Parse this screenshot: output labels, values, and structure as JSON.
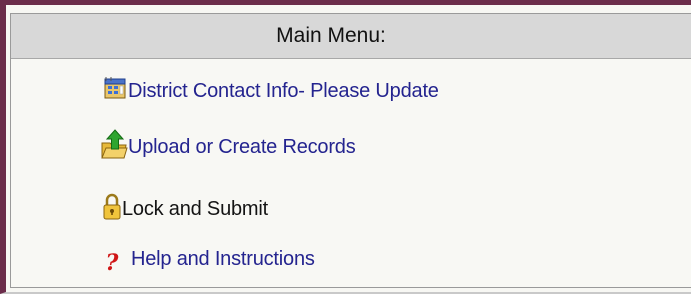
{
  "menu": {
    "title": "Main Menu:",
    "items": [
      {
        "label": "District Contact Info- Please Update",
        "icon": "address-book-icon"
      },
      {
        "label": "Upload or Create Records",
        "icon": "folder-upload-icon"
      },
      {
        "label": "Lock and Submit",
        "icon": "padlock-icon"
      },
      {
        "label": "Help and Instructions",
        "icon": "question-mark-icon"
      }
    ]
  },
  "colors": {
    "frame_border": "#6b2c4a",
    "header_bg": "#d8d8d8",
    "link_text": "#24248f",
    "plain_text": "#141414",
    "help_icon": "#d01616"
  }
}
